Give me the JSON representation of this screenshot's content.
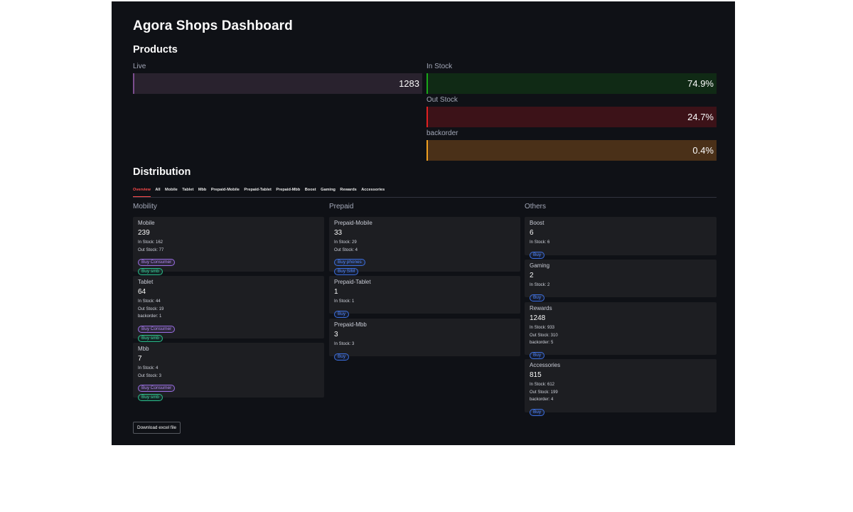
{
  "title": "Agora Shops Dashboard",
  "products": {
    "heading": "Products",
    "live": {
      "label": "Live",
      "value": "1283",
      "color": "#7b4d8e"
    },
    "in_stock": {
      "label": "In Stock",
      "value": "74.9%",
      "color": "#1aa61a"
    },
    "out_stock": {
      "label": "Out Stock",
      "value": "24.7%",
      "color": "#e02020"
    },
    "backorder": {
      "label": "backorder",
      "value": "0.4%",
      "color": "#f0a020"
    }
  },
  "distribution": {
    "heading": "Distribution",
    "tabs": [
      "Overview",
      "All",
      "Mobile",
      "Tablet",
      "Mbb",
      "Prepaid-Mobile",
      "Prepaid-Tablet",
      "Prepaid-Mbb",
      "Boost",
      "Gaming",
      "Rewards",
      "Accessories"
    ],
    "active_tab": "Overview",
    "columns": {
      "mobility": "Mobility",
      "prepaid": "Prepaid",
      "others": "Others"
    },
    "cards": {
      "mobile": {
        "name": "Mobile",
        "count": "239",
        "stats": [
          "In Stock: 162",
          "Out Stock: 77"
        ],
        "badges": [
          "Buy Consumer",
          "Buy smb"
        ]
      },
      "tablet": {
        "name": "Tablet",
        "count": "64",
        "stats": [
          "In Stock: 44",
          "Out Stock: 19",
          "backorder: 1"
        ],
        "badges": [
          "Buy Consumer",
          "Buy smb"
        ]
      },
      "mbb": {
        "name": "Mbb",
        "count": "7",
        "stats": [
          "In Stock: 4",
          "Out Stock: 3"
        ],
        "badges": [
          "Buy Consumer",
          "Buy smb"
        ]
      },
      "prepaid_mobile": {
        "name": "Prepaid-Mobile",
        "count": "33",
        "stats": [
          "In Stock: 29",
          "Out Stock: 4"
        ],
        "badges": [
          "Buy phones",
          "Buy SIM"
        ]
      },
      "prepaid_tablet": {
        "name": "Prepaid-Tablet",
        "count": "1",
        "stats": [
          "In Stock: 1"
        ],
        "badges": [
          "Buy"
        ]
      },
      "prepaid_mbb": {
        "name": "Prepaid-Mbb",
        "count": "3",
        "stats": [
          "In Stock: 3"
        ],
        "badges": [
          "Buy"
        ]
      },
      "boost": {
        "name": "Boost",
        "count": "6",
        "stats": [
          "In Stock: 6"
        ],
        "badges": [
          "Buy"
        ]
      },
      "gaming": {
        "name": "Gaming",
        "count": "2",
        "stats": [
          "In Stock: 2"
        ],
        "badges": [
          "Buy"
        ]
      },
      "rewards": {
        "name": "Rewards",
        "count": "1248",
        "stats": [
          "In Stock: 933",
          "Out Stock: 310",
          "backorder: 5"
        ],
        "badges": [
          "Buy"
        ]
      },
      "accessories": {
        "name": "Accessories",
        "count": "815",
        "stats": [
          "In Stock: 612",
          "Out Stock: 199",
          "backorder: 4"
        ],
        "badges": [
          "Buy"
        ]
      }
    }
  },
  "download_label": "Download excel file"
}
